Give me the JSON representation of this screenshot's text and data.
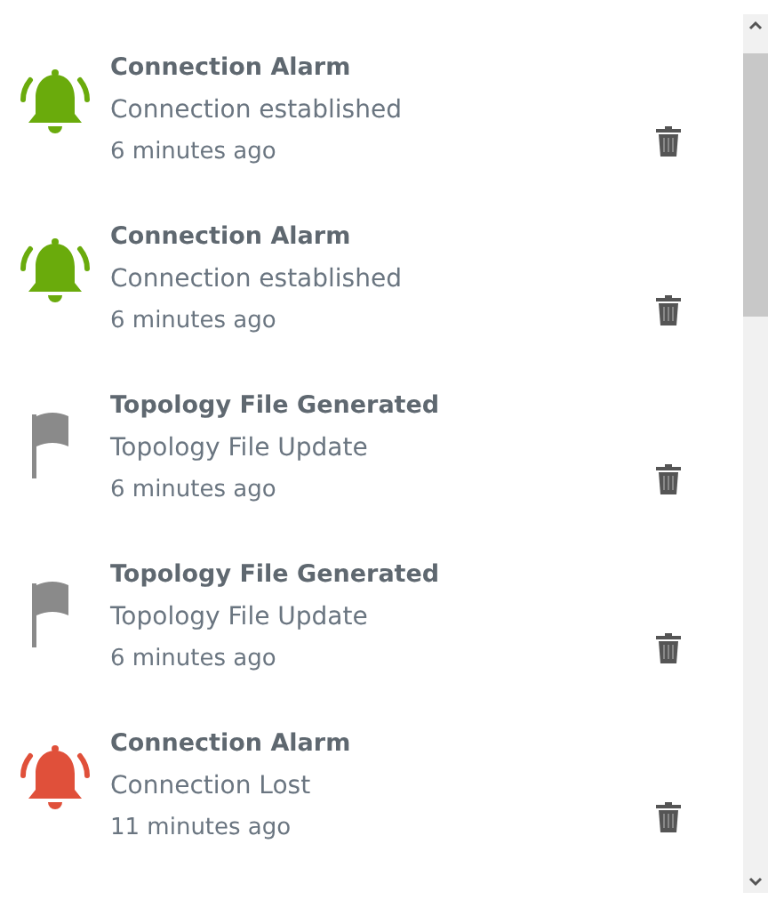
{
  "notifications": [
    {
      "kind": "bell",
      "color": "#6aab0c",
      "title": "Connection Alarm",
      "message": "Connection established",
      "time": "6 minutes ago"
    },
    {
      "kind": "bell",
      "color": "#6aab0c",
      "title": "Connection Alarm",
      "message": "Connection established",
      "time": "6 minutes ago"
    },
    {
      "kind": "flag",
      "color": "#8a8a8a",
      "title": "Topology File Generated",
      "message": "Topology File Update",
      "time": "6 minutes ago"
    },
    {
      "kind": "flag",
      "color": "#8a8a8a",
      "title": "Topology File Generated",
      "message": "Topology File Update",
      "time": "6 minutes ago"
    },
    {
      "kind": "bell",
      "color": "#e0503a",
      "title": "Connection Alarm",
      "message": "Connection Lost",
      "time": "11 minutes ago"
    }
  ]
}
